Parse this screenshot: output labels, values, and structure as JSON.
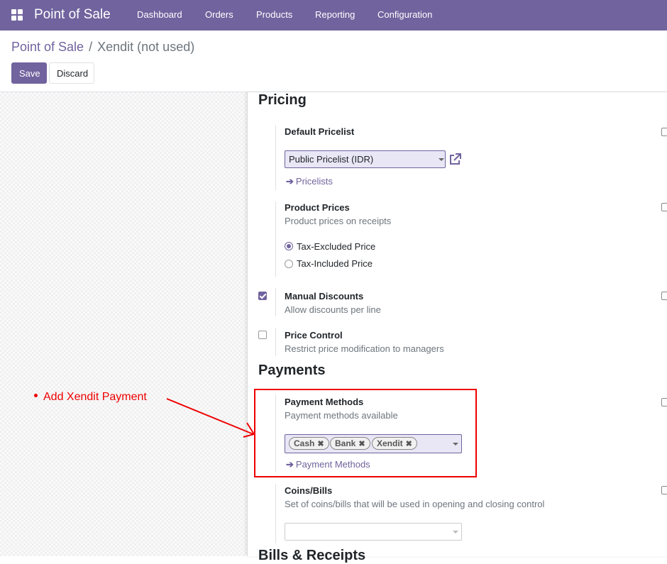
{
  "topbar": {
    "app_name": "Point of Sale",
    "menu": [
      "Dashboard",
      "Orders",
      "Products",
      "Reporting",
      "Configuration"
    ]
  },
  "breadcrumb": {
    "root": "Point of Sale",
    "separator": "/",
    "current": "Xendit (not used)"
  },
  "actions": {
    "save": "Save",
    "discard": "Discard"
  },
  "pricing": {
    "title": "Pricing",
    "default_pricelist": {
      "label": "Default Pricelist",
      "value": "Public Pricelist (IDR)",
      "link": "Pricelists"
    },
    "product_prices": {
      "label": "Product Prices",
      "description": "Product prices on receipts",
      "options": [
        "Tax-Excluded Price",
        "Tax-Included Price"
      ],
      "selected": "Tax-Excluded Price"
    },
    "manual_discounts": {
      "label": "Manual Discounts",
      "description": "Allow discounts per line",
      "checked": true
    },
    "price_control": {
      "label": "Price Control",
      "description": "Restrict price modification to managers",
      "checked": false
    }
  },
  "payments": {
    "title": "Payments",
    "payment_methods": {
      "label": "Payment Methods",
      "description": "Payment methods available",
      "tags": [
        "Cash",
        "Bank",
        "Xendit"
      ],
      "link": "Payment Methods"
    },
    "coins_bills": {
      "label": "Coins/Bills",
      "description": "Set of coins/bills that will be used in opening and closing control"
    }
  },
  "next_section": "Bills & Receipts",
  "annotation": "Add Xendit Payment",
  "colors": {
    "brand": "#71639e",
    "annotation": "#ee0000"
  }
}
